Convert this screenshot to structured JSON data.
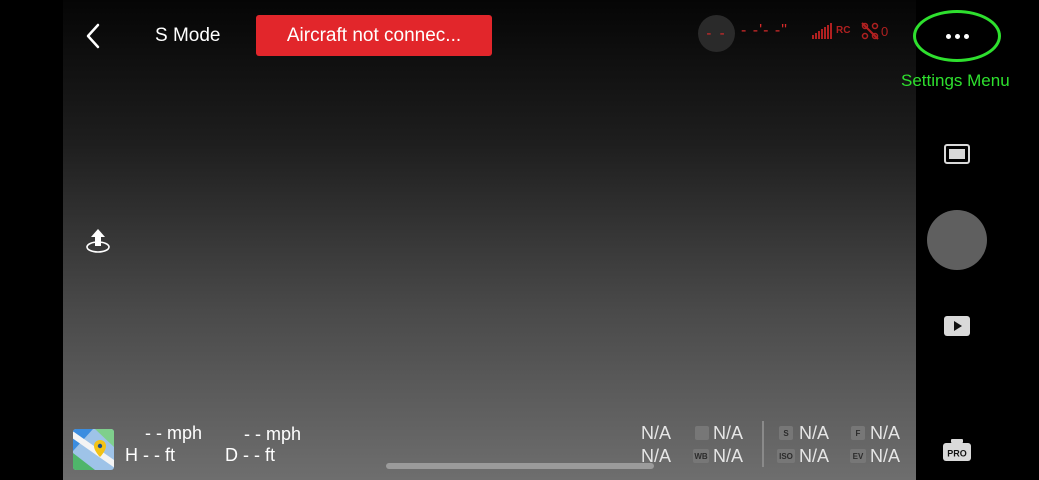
{
  "header": {
    "mode": "S Mode",
    "status_banner": "Aircraft not connec...",
    "satellite_count": "- -",
    "flight_time": "- -'- -\"",
    "rc_label": "RC",
    "aircraft_count": "0"
  },
  "settings": {
    "annotation": "Settings Menu"
  },
  "telemetry": {
    "horizontal_speed": "- - mph",
    "vertical_speed": "- - mph",
    "height": "H - - ft",
    "distance": "D - - ft"
  },
  "camera_params": {
    "p1": "N/A",
    "p2": "N/A",
    "p3": "N/A",
    "p4": "N/A",
    "p5": "N/A",
    "p6": "N/A",
    "p7": "N/A",
    "p8": "N/A",
    "badges": {
      "wb": "WB",
      "s": "S",
      "iso": "ISO",
      "f": "F",
      "ev": "EV"
    }
  },
  "right_panel": {
    "pro_label": "PRO"
  },
  "icons": {
    "back": "chevron-left-icon",
    "settings": "more-dots-icon",
    "takeoff": "takeoff-icon",
    "map": "map-icon",
    "aspect": "aspect-ratio-icon",
    "playback": "playback-icon",
    "pro": "pro-camera-icon"
  },
  "colors": {
    "banner": "#e2262b",
    "warning_text": "#d62a2a",
    "annotation": "#2ee02e"
  }
}
